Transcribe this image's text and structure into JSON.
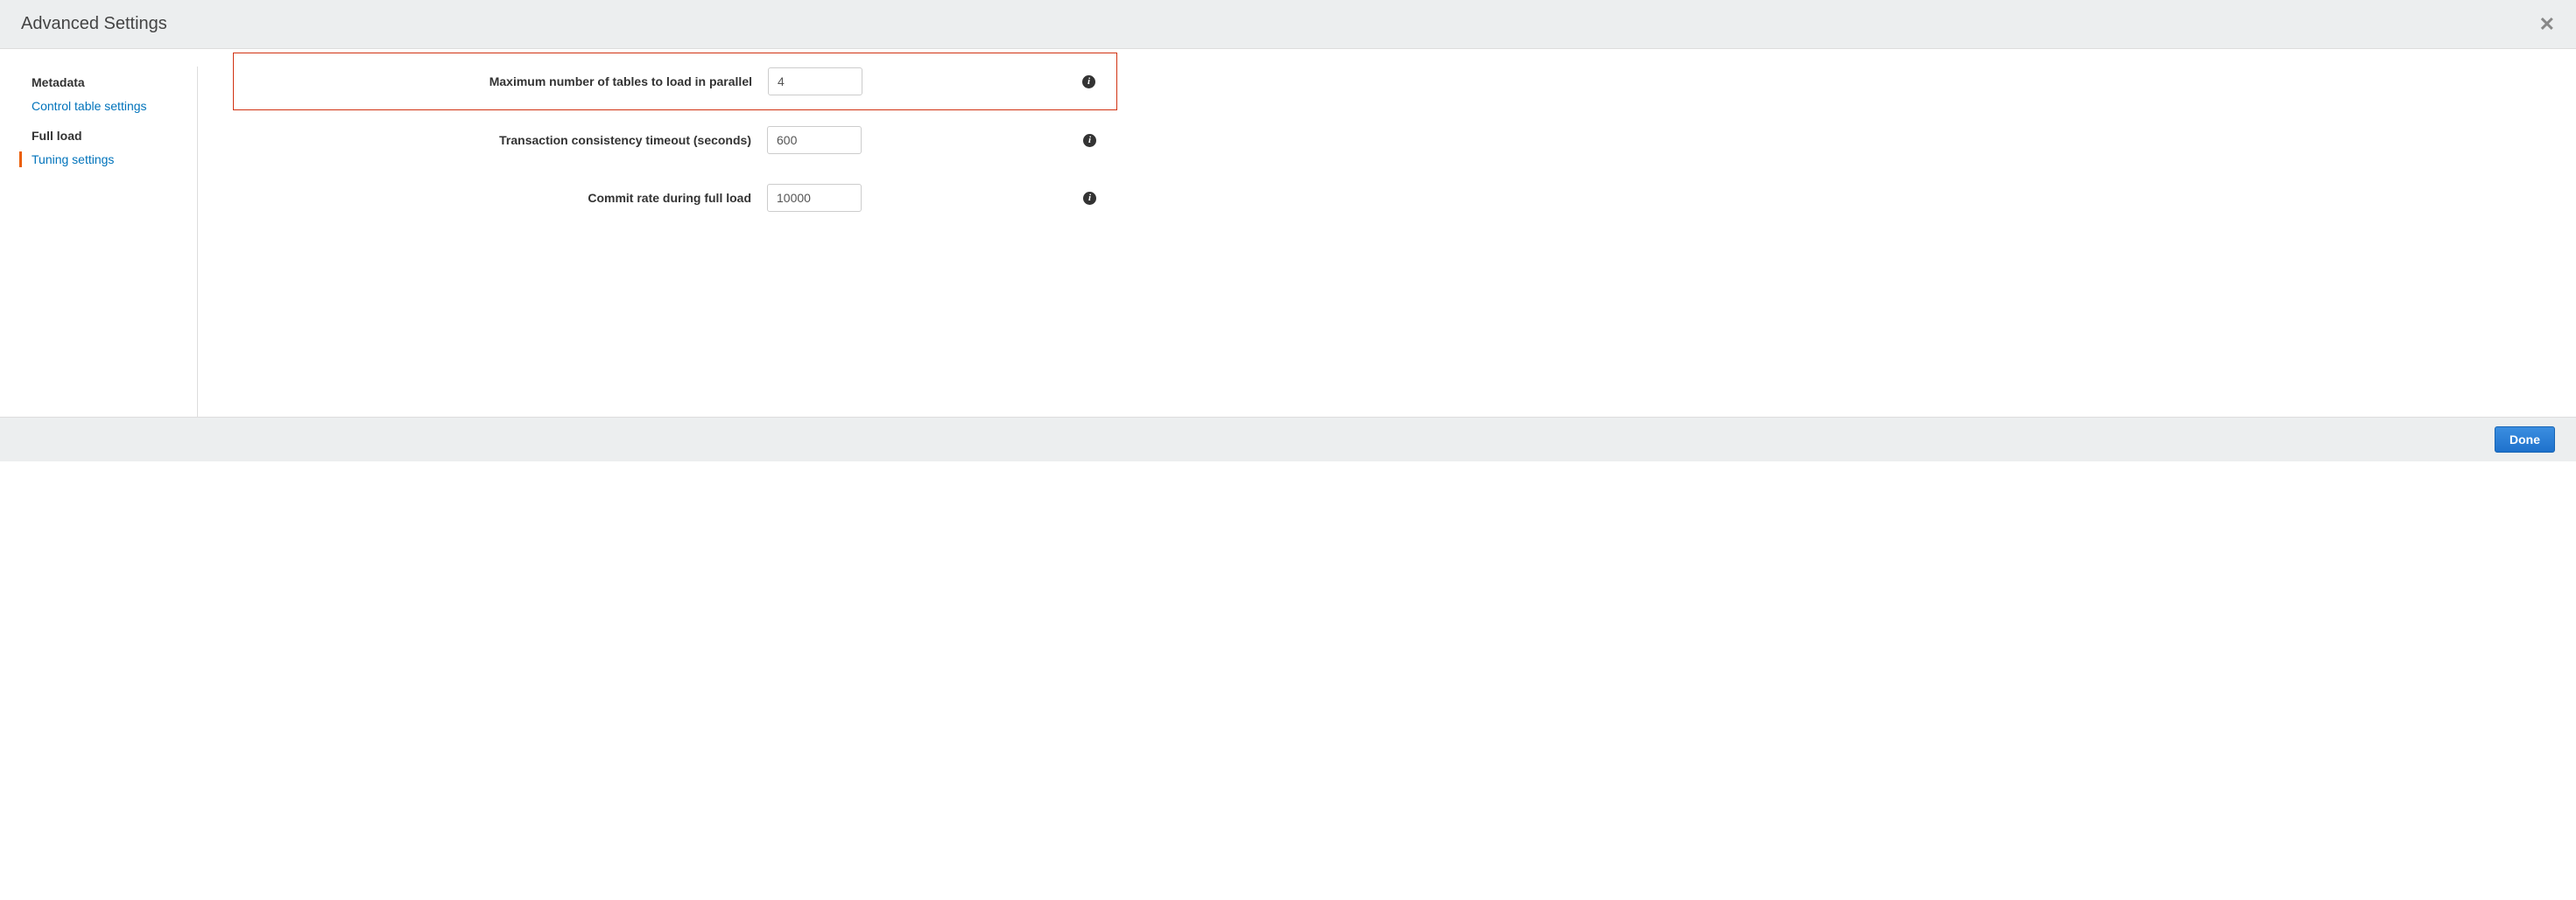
{
  "header": {
    "title": "Advanced Settings"
  },
  "sidebar": {
    "sections": [
      {
        "heading": "Metadata",
        "link": "Control table settings",
        "active": false
      },
      {
        "heading": "Full load",
        "link": "Tuning settings",
        "active": true
      }
    ]
  },
  "form": {
    "rows": [
      {
        "label": "Maximum number of tables to load in parallel",
        "value": "4",
        "highlight": true
      },
      {
        "label": "Transaction consistency timeout (seconds)",
        "value": "600",
        "highlight": false
      },
      {
        "label": "Commit rate during full load",
        "value": "10000",
        "highlight": false
      }
    ]
  },
  "footer": {
    "done": "Done"
  }
}
